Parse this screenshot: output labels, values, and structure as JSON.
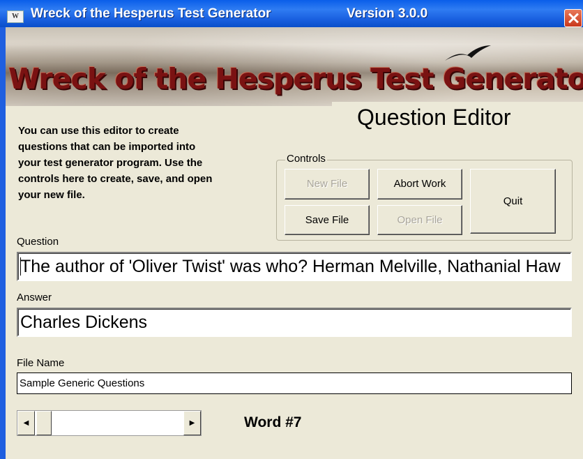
{
  "window": {
    "title": "Wreck of the Hesperus Test Generator",
    "version": "Version 3.0.0",
    "icon_text": "W"
  },
  "banner": {
    "title": "Wreck of the Hesperus Test Generator"
  },
  "editor": {
    "heading": "Question Editor",
    "intro": "You can use this editor to create\nquestions that can be imported into\nyour test generator program.  Use the\ncontrols here to create, save, and open\nyour new file."
  },
  "controls": {
    "group_label": "Controls",
    "new_file": {
      "label": "New File",
      "enabled": false
    },
    "abort_work": {
      "label": "Abort Work",
      "enabled": true
    },
    "quit": {
      "label": "Quit",
      "enabled": true
    },
    "save_file": {
      "label": "Save File",
      "enabled": true
    },
    "open_file": {
      "label": "Open File",
      "enabled": false
    }
  },
  "question": {
    "label": "Question",
    "value": "The author of 'Oliver Twist' was who? Herman Melville, Nathanial Haw"
  },
  "answer": {
    "label": "Answer",
    "value": "Charles Dickens"
  },
  "file_name": {
    "label": "File Name",
    "value": "Sample Generic Questions"
  },
  "scroll": {
    "left_arrow": "◀",
    "right_arrow": "▶"
  },
  "word": {
    "label": "Word #7"
  },
  "colors": {
    "titlebar": "#0a5ee9",
    "window_bg": "#ece9d8",
    "banner_text": "#7a1212",
    "close_button": "#c9381c"
  }
}
